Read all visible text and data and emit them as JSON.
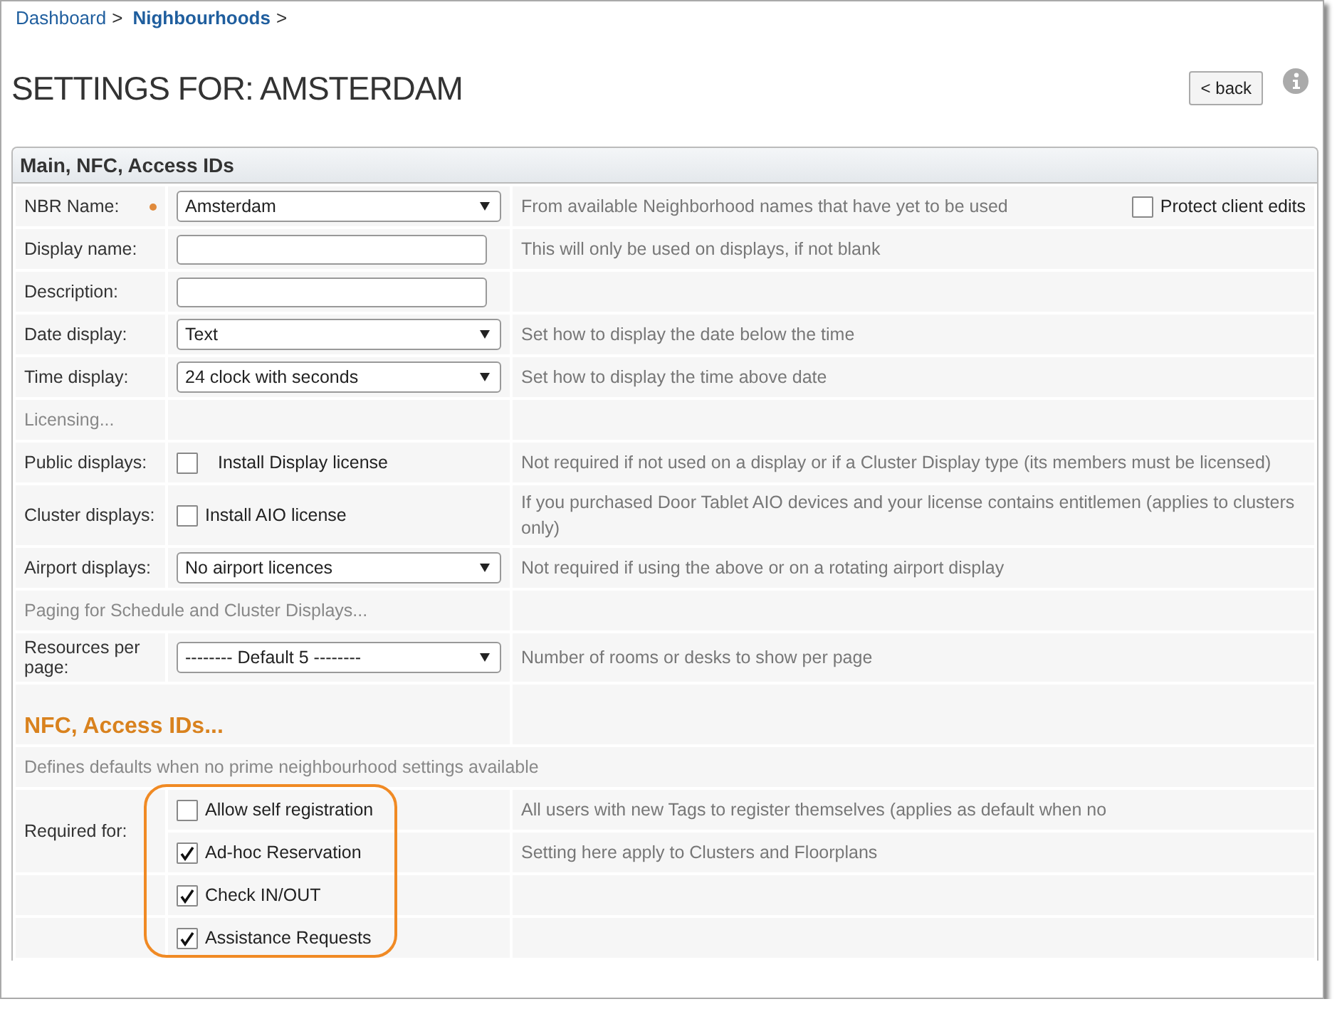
{
  "breadcrumb": [
    {
      "label": "Dashboard",
      "current": false,
      "separator": ">"
    },
    {
      "label": "Nighbourhoods",
      "current": true,
      "separator": ">"
    }
  ],
  "title": "SETTINGS FOR: AMSTERDAM",
  "back_button": "< back",
  "panel": {
    "title": "Main, NFC, Access IDs",
    "rows": [
      {
        "kind": "select",
        "label": "NBR Name:",
        "required": true,
        "value": "Amsterdam",
        "hint": "From available Neighborhood names that have yet to be used",
        "extra": {
          "label": "Protect client edits",
          "checked": false
        }
      },
      {
        "kind": "text",
        "label": "Display name:",
        "hint": "This will only be used on displays, if not blank"
      },
      {
        "kind": "text",
        "label": "Description:"
      },
      {
        "kind": "select",
        "label": "Date display:",
        "value": "Text",
        "hint": "Set how to display the date below the time"
      },
      {
        "kind": "select",
        "label": "Time display:",
        "value": "24 clock with seconds",
        "hint": "Set how to display the time above date"
      },
      {
        "kind": "section",
        "label": "Licensing..."
      },
      {
        "kind": "checkbox",
        "label": "Public displays:",
        "option": "Install Display license",
        "checked": false,
        "hint": "Not required if not used on a display or if a Cluster Display type (its members must be licensed)"
      },
      {
        "kind": "checkbox",
        "label": "Cluster displays:",
        "option": "Install AIO license",
        "checked": false,
        "hint": "If you purchased Door Tablet AIO devices and your license contains entitlemen (applies to clusters only)"
      },
      {
        "kind": "select",
        "label": "Airport displays:",
        "value": "No airport licences",
        "hint": "Not required if using the above or on a rotating airport display"
      },
      {
        "kind": "note",
        "text": "Paging for Schedule and Cluster Displays..."
      },
      {
        "kind": "select",
        "label": "Resources per page:",
        "value": "-------- Default 5 --------",
        "hint": "Number of rooms or desks to show per page"
      },
      {
        "kind": "heading",
        "text": "NFC, Access IDs..."
      },
      {
        "kind": "wide",
        "text": "Defines defaults when no prime neighbourhood settings available"
      }
    ],
    "required_for": {
      "label": "Required for:",
      "highlighted": true,
      "options": [
        {
          "label": "Allow self registration",
          "checked": false,
          "hint": "All users with new Tags to register themselves (applies as default when no"
        },
        {
          "label": "Ad-hoc Reservation",
          "checked": true,
          "hint": "Setting here apply to Clusters and Floorplans"
        },
        {
          "label": "Check IN/OUT",
          "checked": true
        },
        {
          "label": "Assistance Requests",
          "checked": true
        }
      ]
    }
  }
}
